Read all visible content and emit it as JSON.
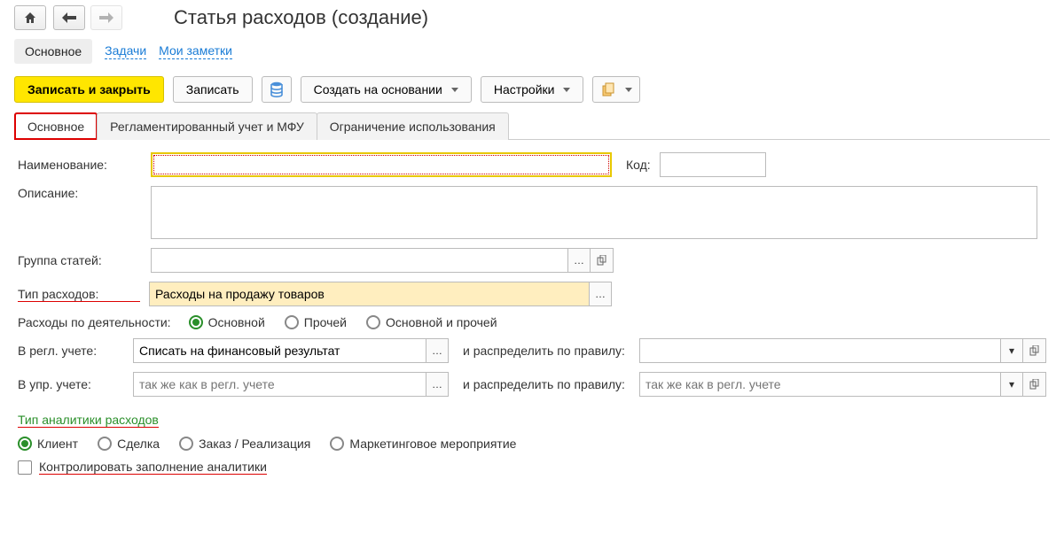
{
  "title": "Статья расходов (создание)",
  "topnav": {
    "items": [
      "Основное",
      "Задачи",
      "Мои заметки"
    ],
    "active_index": 0
  },
  "toolbar": {
    "save_close": "Записать и закрыть",
    "save": "Записать",
    "create_based": "Создать на основании",
    "settings": "Настройки"
  },
  "card_tabs": {
    "items": [
      "Основное",
      "Регламентированный учет и МФУ",
      "Ограничение использования"
    ],
    "active_index": 0
  },
  "form": {
    "name_label": "Наименование:",
    "name_value": "",
    "code_label": "Код:",
    "code_value": "",
    "desc_label": "Описание:",
    "desc_value": "",
    "group_label": "Группа статей:",
    "group_value": "",
    "type_label": "Тип расходов:",
    "type_value": "Расходы на продажу товаров",
    "activity_label": "Расходы по деятельности:",
    "activity_options": [
      "Основной",
      "Прочей",
      "Основной и прочей"
    ],
    "activity_selected": 0,
    "reg_label": "В регл. учете:",
    "reg_value": "Списать на финансовый результат",
    "reg_rule_label": "и распределить по правилу:",
    "reg_rule_value": "",
    "mgmt_label": "В упр. учете:",
    "mgmt_placeholder": "так же как в регл. учете",
    "mgmt_rule_label": "и распределить по правилу:",
    "mgmt_rule_placeholder": "так же как в регл. учете",
    "analytics_title": "Тип аналитики расходов",
    "analytics_options": [
      "Клиент",
      "Сделка",
      "Заказ / Реализация",
      "Маркетинговое мероприятие"
    ],
    "analytics_selected": 0,
    "control_label": "Контролировать заполнение аналитики"
  }
}
